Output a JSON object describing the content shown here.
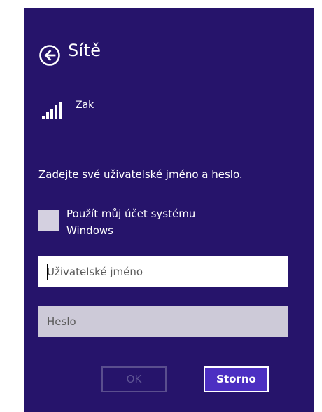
{
  "header": {
    "back_icon": "arrow-left-circle-icon",
    "title": "Sítě"
  },
  "network": {
    "signal_icon": "signal-bars-icon",
    "name": "Zak"
  },
  "form": {
    "instruction": "Zadejte své uživatelské jméno a heslo.",
    "use_windows_account": {
      "label": "Použít můj účet systému Windows",
      "checked": false
    },
    "username": {
      "placeholder": "Uživatelské jméno",
      "value": ""
    },
    "password": {
      "placeholder": "Heslo",
      "value": ""
    }
  },
  "buttons": {
    "ok_label": "OK",
    "ok_enabled": false,
    "cancel_label": "Storno"
  },
  "colors": {
    "panel_background": "#26146b",
    "accent_button": "#4c2fc2",
    "text": "#ffffff"
  }
}
